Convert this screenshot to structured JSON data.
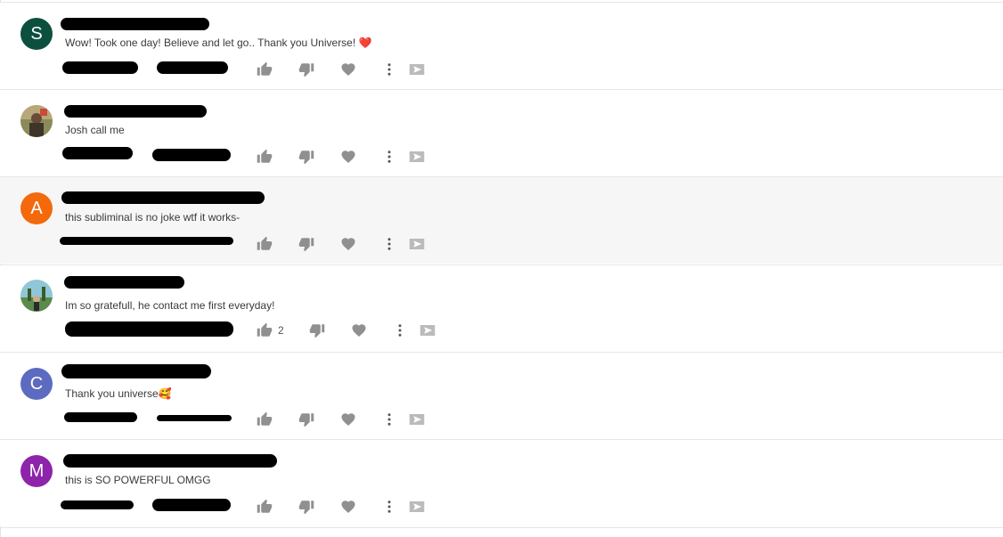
{
  "comments": [
    {
      "avatar_letter": "S",
      "avatar_color": "#0d4f3f",
      "text": "Wow! Took one day! Believe and let go.. Thank you Universe! ❤️",
      "likes": ""
    },
    {
      "avatar_letter": "",
      "avatar_color": "#8a7a4a",
      "text": "Josh call me",
      "likes": ""
    },
    {
      "avatar_letter": "A",
      "avatar_color": "#f4690b",
      "text": "this subliminal is no joke wtf it works-",
      "likes": ""
    },
    {
      "avatar_letter": "",
      "avatar_color": "#4a7a6a",
      "text": "Im so gratefull, he contact me first everyday!",
      "likes": "2"
    },
    {
      "avatar_letter": "C",
      "avatar_color": "#5c6bc0",
      "text": "Thank you universe🥰",
      "likes": ""
    },
    {
      "avatar_letter": "M",
      "avatar_color": "#8e24aa",
      "text": "this is SO POWERFUL OMGG",
      "likes": ""
    }
  ],
  "icons": [
    "thumb-up-icon",
    "thumb-down-icon",
    "heart-icon",
    "more-vert-icon",
    "reply-arrow-icon"
  ],
  "colors": {
    "icon": "#909090",
    "redaction": "#000000",
    "highlight_row": "#f6f6f6"
  }
}
